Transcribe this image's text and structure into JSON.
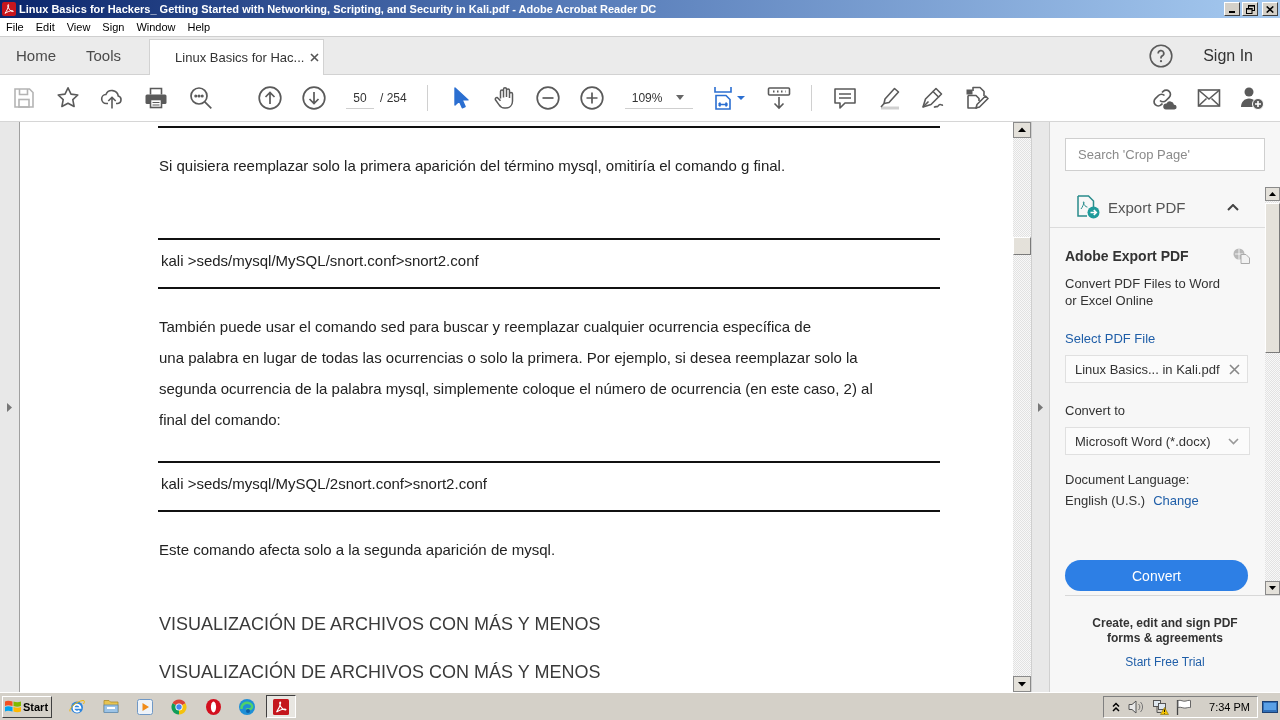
{
  "window": {
    "title": "Linux Basics for Hackers_ Getting Started with Networking, Scripting, and Security in Kali.pdf - Adobe Acrobat Reader DC"
  },
  "menu": [
    "File",
    "Edit",
    "View",
    "Sign",
    "Window",
    "Help"
  ],
  "nav_tabs": [
    {
      "label": "Home",
      "selected": false
    },
    {
      "label": "Tools",
      "selected": false
    }
  ],
  "document_tabs": [
    {
      "label": "Linux Basics for Hac...",
      "selected": true
    }
  ],
  "sign_in": "Sign In",
  "toolbar": {
    "save": {
      "disabled": true
    },
    "page_number": "50",
    "page_count": "/ 254",
    "pointer_tools": [
      {
        "kind": "select",
        "selected": true
      },
      {
        "kind": "hand",
        "selected": false
      }
    ],
    "zoom": "109%"
  },
  "document": {
    "blocks": [
      {
        "kind": "rule"
      },
      {
        "kind": "paragraph",
        "lines": [
          "Si quisiera reemplazar solo la primera aparición del término mysql, omitiría el comando g final."
        ]
      },
      {
        "kind": "code",
        "text": "kali >seds/mysql/MySQL/snort.conf>snort2.conf"
      },
      {
        "kind": "paragraph",
        "lines": [
          "También puede usar el comando sed para buscar y reemplazar cualquier ocurrencia específica de",
          "una palabra en lugar de todas las ocurrencias o solo la primera. Por ejemplo, si desea reemplazar solo la",
          "segunda ocurrencia de la palabra mysql, simplemente coloque el número de ocurrencia (en este caso, 2) al",
          "final del comando:"
        ]
      },
      {
        "kind": "code",
        "text": "kali >seds/mysql/MySQL/2snort.conf>snort2.conf"
      },
      {
        "kind": "paragraph",
        "lines": [
          "Este comando afecta solo a la segunda aparición de mysql."
        ]
      },
      {
        "kind": "heading",
        "text": "VISUALIZACIÓN DE ARCHIVOS CON MÁS Y MENOS"
      },
      {
        "kind": "heading",
        "text": "VISUALIZACIÓN DE ARCHIVOS CON MÁS Y MENOS"
      }
    ]
  },
  "tools_pane": {
    "search": {
      "placeholder": "Search 'Crop Page'"
    },
    "section": {
      "title": "Export PDF",
      "expanded": true
    },
    "heading": "Adobe Export PDF",
    "description": [
      "Convert PDF Files to Word",
      "or Excel Online"
    ],
    "select_link": "Select PDF File",
    "file": {
      "value": "Linux Basics... in Kali.pdf"
    },
    "convert_to_label": "Convert to",
    "format": {
      "value": "Microsoft Word (*.docx)"
    },
    "language_label": "Document Language:",
    "language": "English (U.S.)",
    "change_link": "Change",
    "convert_button": "Convert",
    "promo": {
      "lines": [
        "Create, edit and sign PDF",
        "forms & agreements"
      ],
      "link": "Start Free Trial"
    }
  },
  "taskbar": {
    "start": "Start",
    "apps": [
      {
        "kind": "e_logo",
        "selected": false
      },
      {
        "kind": "folder",
        "selected": false
      },
      {
        "kind": "player",
        "selected": false
      },
      {
        "kind": "ring",
        "selected": false
      },
      {
        "kind": "o_logo",
        "selected": false
      },
      {
        "kind": "swirl",
        "selected": false
      },
      {
        "kind": "pdf",
        "selected": true
      }
    ],
    "clock": "7:34 PM"
  }
}
